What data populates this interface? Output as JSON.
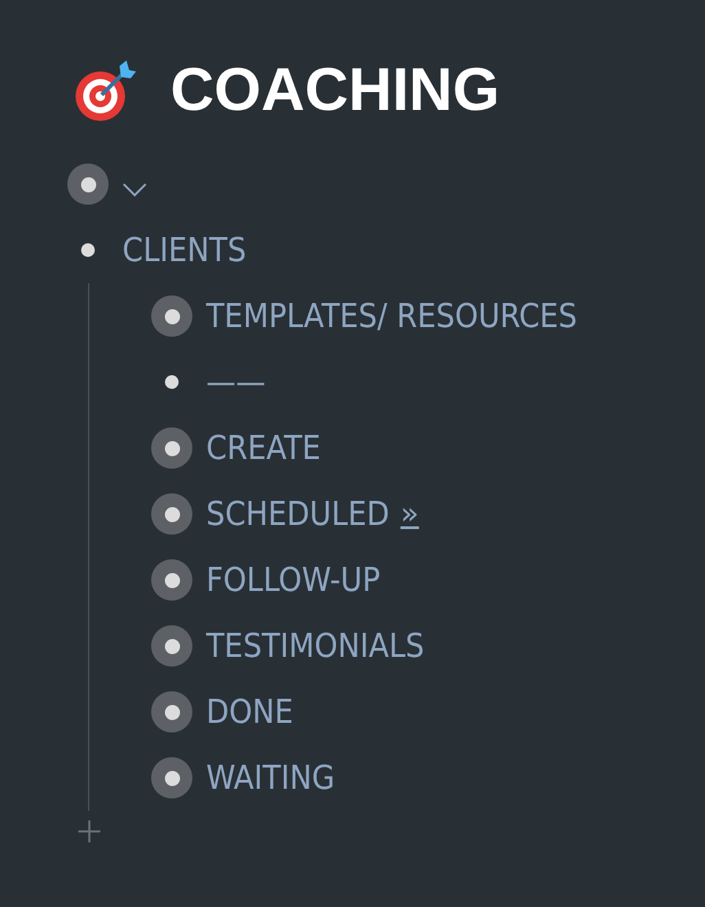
{
  "title": "COACHING",
  "items": [
    {
      "collapsed": true,
      "expand_toggle": true
    },
    {
      "text": "CLIENTS",
      "collapsed": false,
      "children": [
        {
          "text": "TEMPLATES/ RESOURCES",
          "collapsed": true
        },
        {
          "text": "——",
          "collapsed": false
        },
        {
          "text": "CREATE",
          "collapsed": true
        },
        {
          "text": "SCHEDULED",
          "link": "»",
          "collapsed": true
        },
        {
          "text": "FOLLOW-UP",
          "collapsed": true
        },
        {
          "text": "TESTIMONIALS",
          "collapsed": true
        },
        {
          "text": "DONE",
          "collapsed": true
        },
        {
          "text": "WAITING",
          "collapsed": true
        }
      ]
    }
  ]
}
